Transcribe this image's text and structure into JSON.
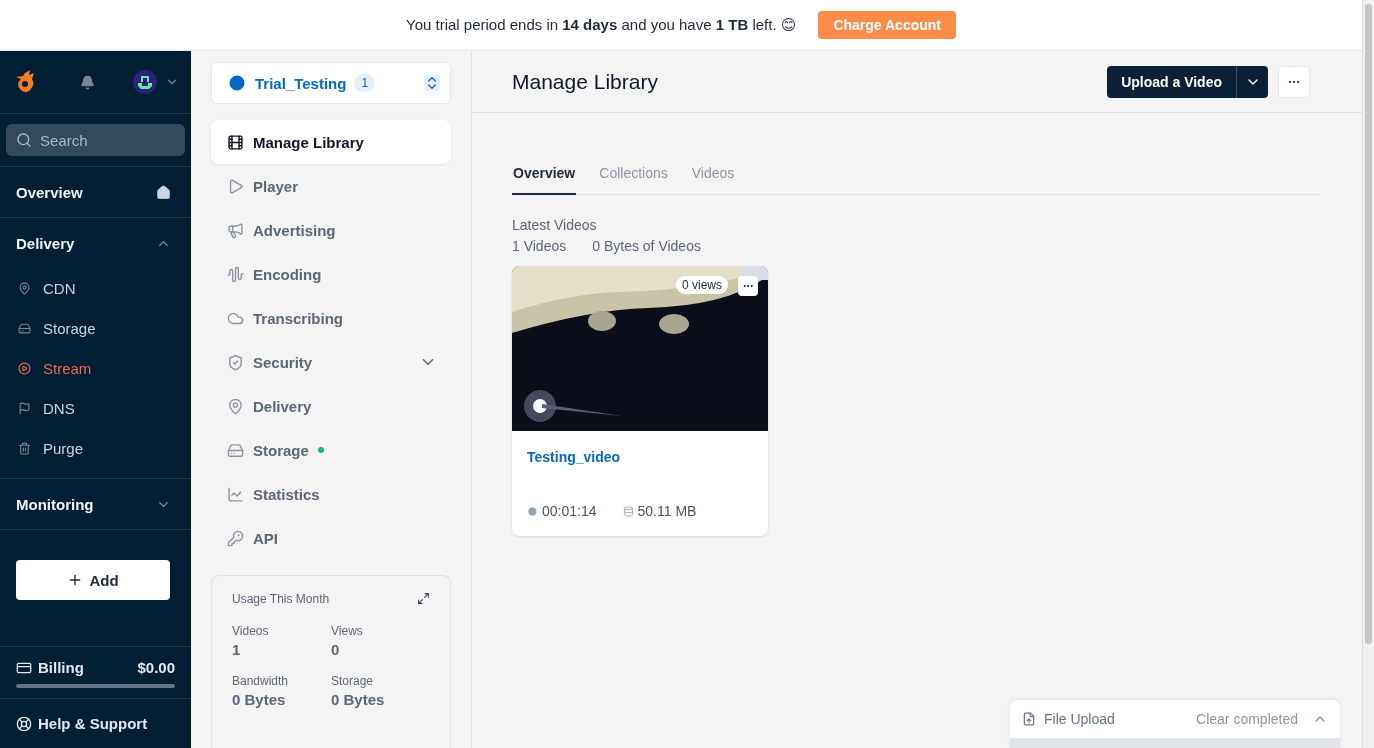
{
  "banner": {
    "text": "You trial period ends in **14 days** and you have **1 TB** left. 😊",
    "button": "Charge Account"
  },
  "sidebar": {
    "search": {
      "placeholder": "Search"
    },
    "sections": [
      {
        "label": "Overview",
        "kind": "link"
      },
      {
        "label": "Delivery",
        "kind": "group",
        "expanded": true,
        "items": [
          {
            "label": "CDN",
            "selected": false
          },
          {
            "label": "Storage",
            "selected": false
          },
          {
            "label": "Stream",
            "selected": true
          },
          {
            "label": "DNS",
            "selected": false
          },
          {
            "label": "Purge",
            "selected": false
          }
        ]
      },
      {
        "label": "Monitoring",
        "kind": "group",
        "expanded": false
      }
    ],
    "add_button": "Add",
    "billing": {
      "label": "Billing",
      "amount": "$0.00"
    },
    "help": "Help & Support"
  },
  "library": {
    "name": "Trial_Testing",
    "count": "1",
    "menu": [
      {
        "label": "Manage Library",
        "selected": true
      },
      {
        "label": "Player",
        "selected": false
      },
      {
        "label": "Advertising",
        "selected": false
      },
      {
        "label": "Encoding",
        "selected": false
      },
      {
        "label": "Transcribing",
        "selected": false
      },
      {
        "label": "Security",
        "selected": false,
        "expanded": false
      },
      {
        "label": "Delivery",
        "selected": false
      },
      {
        "label": "Storage",
        "selected": false,
        "color": "#10b981"
      },
      {
        "label": "Statistics",
        "selected": false
      },
      {
        "label": "API",
        "selected": false
      }
    ],
    "usage": {
      "title": "Usage This Month",
      "stats": [
        {
          "label": "Videos",
          "value": "1"
        },
        {
          "label": "Views",
          "value": "0"
        },
        {
          "label": "Bandwidth",
          "value": "0 Bytes"
        },
        {
          "label": "Storage",
          "value": "0 Bytes"
        }
      ]
    }
  },
  "main": {
    "title": "Manage Library",
    "upload_button": "Upload a Video",
    "tabs": [
      {
        "label": "Overview",
        "selected": true
      },
      {
        "label": "Collections",
        "selected": false
      },
      {
        "label": "Videos",
        "selected": false
      }
    ],
    "section_title": "Latest Videos",
    "video_count": "1 Videos",
    "bytes": "0 Bytes of Videos",
    "videos": [
      {
        "title": "Testing_video",
        "views": "0 views",
        "duration": "00:01:14",
        "size": "50.11 MB"
      }
    ]
  },
  "file_upload": {
    "title": "File Upload",
    "clear": "Clear completed",
    "expanded": false
  }
}
